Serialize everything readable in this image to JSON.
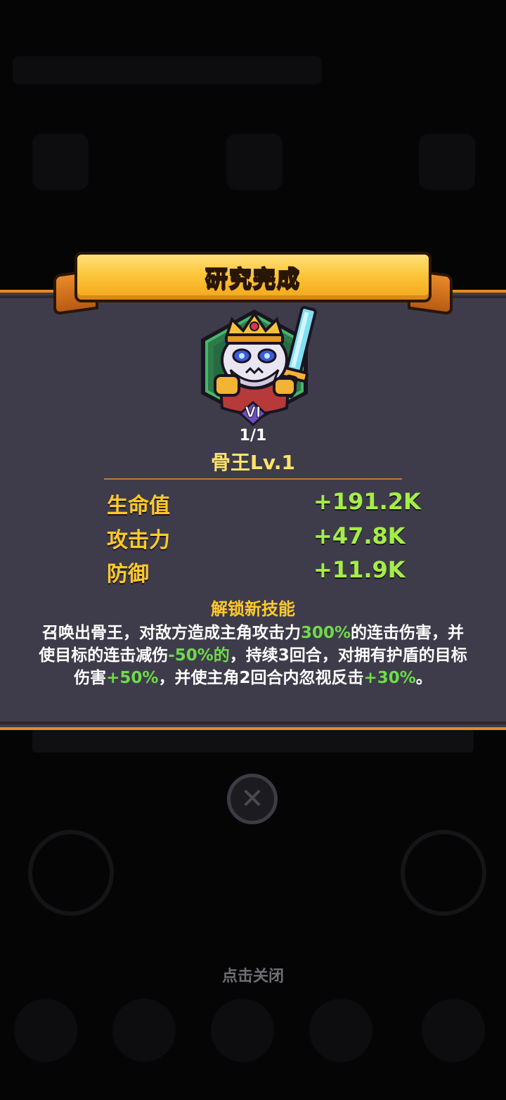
{
  "dialog": {
    "title": "研究完成",
    "hero": {
      "rank": "VI",
      "count": "1/1",
      "name": "骨王Lv.1"
    },
    "stats": [
      {
        "label": "生命值",
        "value": "+191.2K"
      },
      {
        "label": "攻击力",
        "value": "+47.8K"
      },
      {
        "label": "防御",
        "value": "+11.9K"
      }
    ],
    "skill": {
      "title": "解锁新技能",
      "segments": [
        {
          "text": "召唤出骨王，对敌方造成主角攻击力",
          "highlight": false
        },
        {
          "text": "300%",
          "highlight": true
        },
        {
          "text": "的连击伤害，并使目标的连击减伤",
          "highlight": false
        },
        {
          "text": "-50%的",
          "highlight": true
        },
        {
          "text": "，持续3回合，对拥有护盾的目标伤害",
          "highlight": false
        },
        {
          "text": "+50%",
          "highlight": true
        },
        {
          "text": "，并使主角2回合内忽视反击",
          "highlight": false
        },
        {
          "text": "+30%",
          "highlight": true
        },
        {
          "text": "。",
          "highlight": false
        }
      ]
    }
  },
  "close_button": {
    "icon": "close-icon"
  },
  "footer": {
    "tap_to_close": "点击关闭"
  },
  "colors": {
    "banner": "#fcc63a",
    "panel": "#3e3c4a",
    "border": "#e88a22",
    "stat_label": "#ffc92a",
    "stat_value": "#a4ee46",
    "highlight": "#6edb4a"
  }
}
